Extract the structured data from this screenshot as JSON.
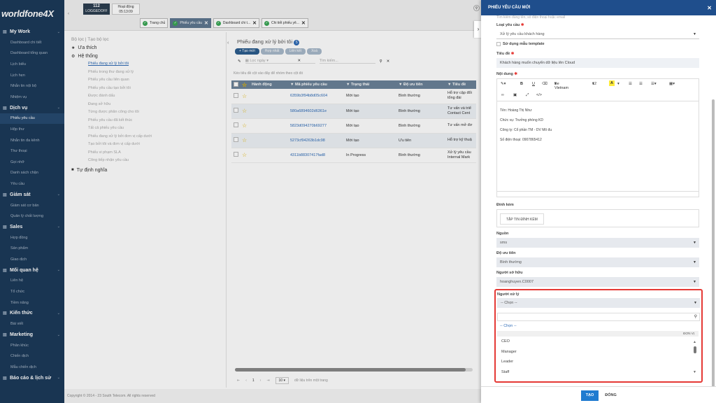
{
  "app": {
    "logo": "worldfone4X",
    "ext_number": "112",
    "ext_status": "LOGGEDOFF",
    "activity_label": "Hoạt động",
    "activity_time": "05:13:09"
  },
  "sidebar": {
    "sections": [
      {
        "label": "My Work",
        "items": [
          "Dashboard chi tiết",
          "Dashboard tổng quan",
          "Lịch biểu",
          "Lịch hẹn",
          "Nhắn tin nội bộ",
          "Nhiệm vụ"
        ]
      },
      {
        "label": "Dịch vụ",
        "items": [
          "Phiếu yêu cầu",
          "Hộp thư",
          "Nhắn tin đa kênh",
          "Thư thoại",
          "Gọi nhỡ",
          "Danh sách chặn",
          "Yêu cầu"
        ]
      },
      {
        "label": "Giám sát",
        "items": [
          "Giám sát cơ bản",
          "Quản lý chất lượng"
        ]
      },
      {
        "label": "Sales",
        "items": [
          "Hợp đồng",
          "Sản phẩm",
          "Giao dịch"
        ]
      },
      {
        "label": "Mối quan hệ",
        "items": [
          "Liên hệ",
          "Tổ chức",
          "Tiềm năng"
        ]
      },
      {
        "label": "Kiến thức",
        "items": [
          "Bài viết"
        ]
      },
      {
        "label": "Marketing",
        "items": [
          "Phân khúc",
          "Chiến dịch",
          "Mẫu chiến dịch"
        ]
      },
      {
        "label": "Báo cáo & lịch sử",
        "items": []
      }
    ]
  },
  "tabs": [
    "Trang chủ",
    "Phiếu yêu cầu",
    "Dashboard chi t...",
    "Chi tiết phiếu yê..."
  ],
  "filter": {
    "head": "Bộ lọc",
    "head2": "Tạo bộ lọc",
    "favorites": "Ưa thích",
    "system": "Hệ thống",
    "custom": "Tự định nghĩa",
    "items": [
      "Phiếu đang xử lý bởi tôi",
      "Phiếu trong thư đang xử lý",
      "Phiếu yêu cầu liên quan",
      "Phiếu yêu cầu tạo bởi tôi",
      "Được đánh dấu",
      "Đang sở hữu",
      "Từng được phân công cho tôi",
      "Phiếu yêu cầu đã kết thúc",
      "Tất cả phiếu yêu cầu",
      "Phiếu đang xử lý bởi đơn vị cấp dưới",
      "Tạo bởi tôi và đơn vị cấp dưới",
      "Phiếu vi phạm SLA",
      "Công tiếp nhận yêu cầu"
    ]
  },
  "main": {
    "title": "Phiếu đang xử lý bởi tôi",
    "count": "5",
    "btn_new": "+ Tạo mới",
    "btn2": "Hợp nhất",
    "btn3": "Liên kết",
    "btn4": "Xoá",
    "date_placeholder": "Lọc ngày",
    "search_placeholder": "Tìm kiếm...",
    "hint": "Kéo tiêu đề cột vào đây để nhóm theo cột đó",
    "columns": [
      "Hành động",
      "Mã phiếu yêu cầu",
      "Trạng thái",
      "Độ ưu tiên",
      "Tiêu đề"
    ],
    "rows": [
      {
        "code": "6359b3f94b8d05c604",
        "status": "Mới tạo",
        "priority": "Bình thường",
        "title": "Hỗ trợ cập đổi",
        "title2": "tổng đài"
      },
      {
        "code": "580a6894602d6361e",
        "status": "Mới tạo",
        "priority": "Bình thường",
        "title": "Tư vấn và triể",
        "title2": "Contact Cent"
      },
      {
        "code": "5823d094270b69277",
        "status": "Mới tạo",
        "priority": "Bình thường",
        "title": "Tư vấn mở đơ",
        "title2": ""
      },
      {
        "code": "5273cf94263b1dc98",
        "status": "Mới tạo",
        "priority": "Ưu tiên",
        "title": "Hỗ trợ kỹ thuậ",
        "title2": ""
      },
      {
        "code": "4311b88307417fad8",
        "status": "In Progress",
        "priority": "Bình thường",
        "title": "Xử lý yêu cầu",
        "title2": "Internal Mark"
      }
    ],
    "page": "1",
    "page_size": "10",
    "pager_text": "dữ liệu trên một trang"
  },
  "footer": "Copyright © 2014 - 23 South Telecom. All rights reserved",
  "panel": {
    "title": "PHIẾU YÊU CẦU MỚI",
    "top_cut": "Tìm kiếm đúng tên, số điện thoại hoặc email",
    "type_label": "Loại yêu cầu",
    "type_value": "Xử lý yêu cầu khách hàng",
    "template_label": "Sử dụng mẫu template",
    "subject_label": "Tiêu đề",
    "subject_value": "Khách hàng muốn chuyển dữ liệu lên Cloud",
    "content_label": "Nội dung",
    "font_name": "Be Vietnam",
    "font_size": "12",
    "content_lines": [
      "Tên: Hoàng Thị Như",
      "Chức vụ: Trưởng phòng KD",
      "Công ty: Cổ phần TM - DV Mô đu",
      "Số điện thoại: 0907865412"
    ],
    "attach_label": "Đính kèm",
    "attach_btn": "TẬP TIN ĐÍNH KÈM",
    "source_label": "Nguồn",
    "source_value": "sms",
    "priority_label": "Độ ưu tiên",
    "priority_value": "Bình thường",
    "owner_label": "Người sở hữu",
    "owner_value": "hoanghuyen.C0007",
    "handler_label": "Người xử lý",
    "handler_value": "-- Chọn --",
    "dropdown": {
      "selected": "-- Chọn --",
      "col_header": "ĐƠN VỊ",
      "options": [
        "CEO",
        "Manager",
        "Leader",
        "Staff"
      ]
    },
    "btn_create": "TẠO",
    "btn_close": "ĐÓNG"
  }
}
